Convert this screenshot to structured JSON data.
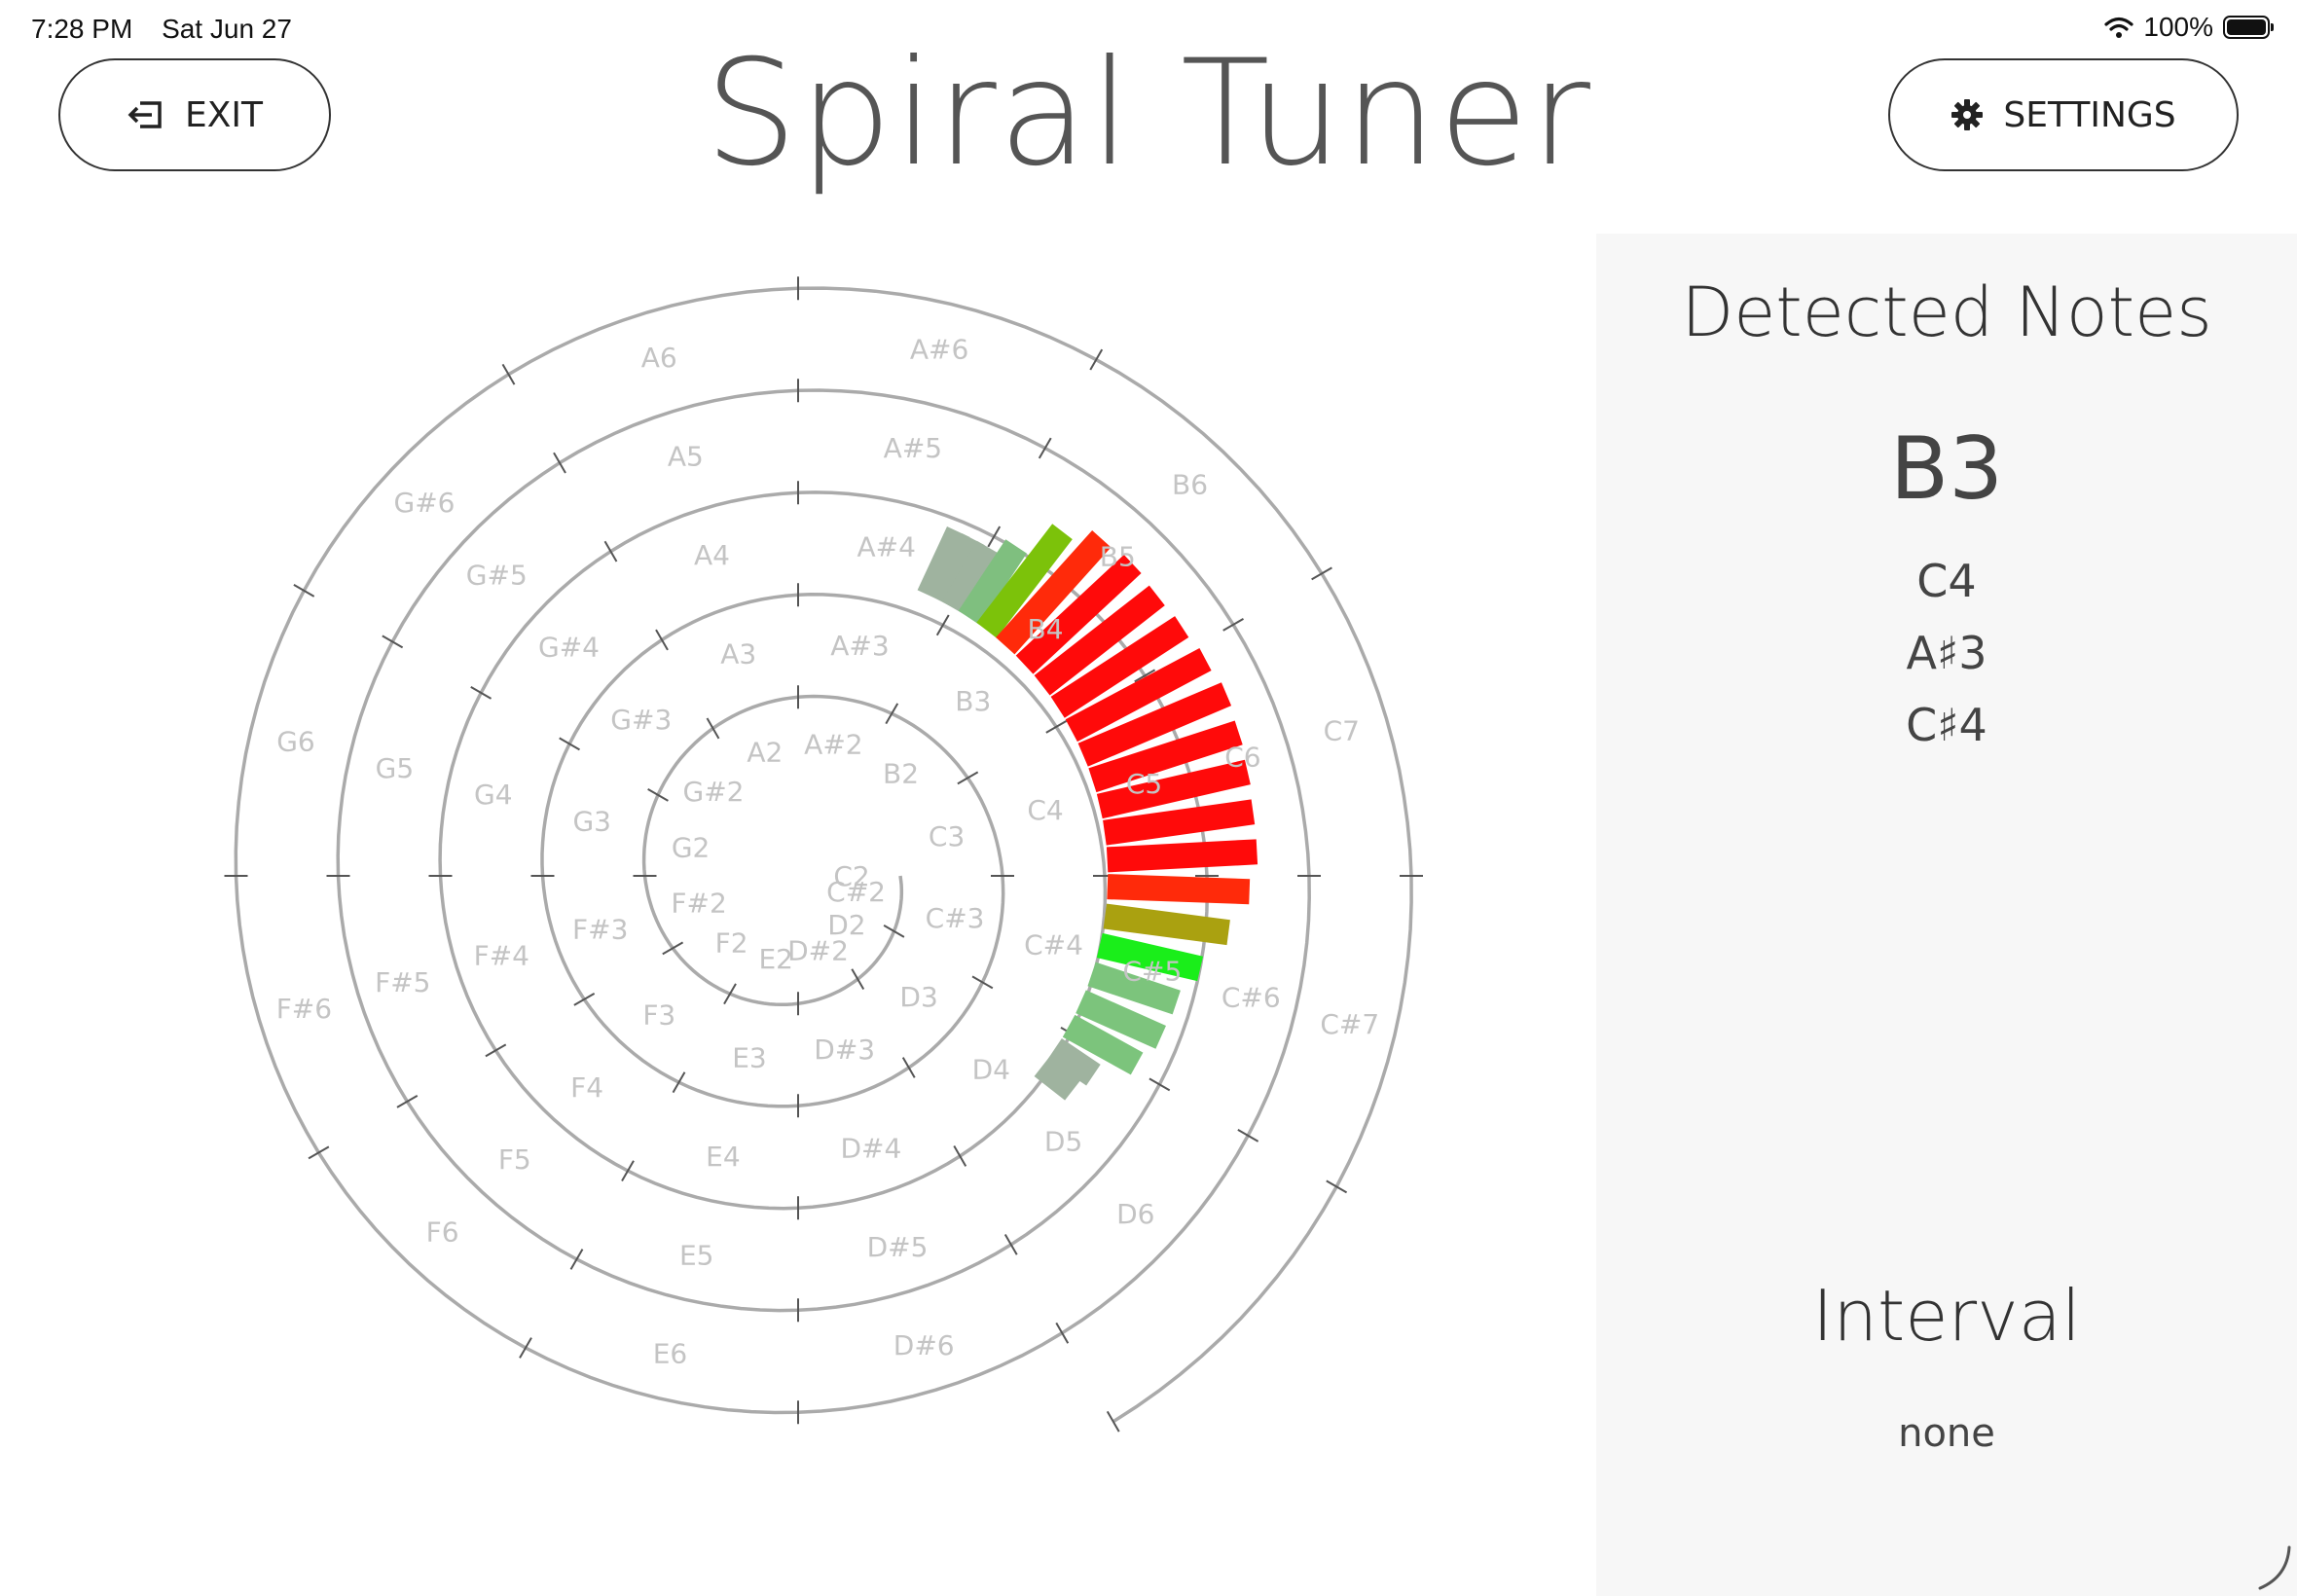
{
  "status_bar": {
    "time": "7:28 PM",
    "date": "Sat Jun 27",
    "battery_text": "100%",
    "icons": [
      "wifi-icon",
      "battery-icon"
    ]
  },
  "header": {
    "exit_label": "EXIT",
    "exit_icon": "exit-icon",
    "title": "Spiral Tuner",
    "settings_label": "SETTINGS",
    "settings_icon": "gear-icon"
  },
  "spiral": {
    "c_labels": [
      "C2",
      "C3",
      "C4",
      "C5",
      "C6",
      "C7"
    ],
    "notes": [
      [
        "C#2",
        "D2",
        "D#2",
        "E2",
        "F2",
        "F#2",
        "G2",
        "G#2",
        "A2",
        "A#2",
        "B2"
      ],
      [
        "C3",
        "C#3",
        "D3",
        "D#3",
        "E3",
        "F3",
        "F#3",
        "G3",
        "G#3",
        "A3",
        "A#3",
        "B3"
      ],
      [
        "C4",
        "C#4",
        "D4",
        "D#4",
        "E4",
        "F4",
        "F#4",
        "G4",
        "G#4",
        "A4",
        "A#4",
        "B4"
      ],
      [
        "C5",
        "C#5",
        "D5",
        "D#5",
        "E5",
        "F5",
        "F#5",
        "G5",
        "G#5",
        "A5",
        "A#5",
        "B5"
      ],
      [
        "C6",
        "C#6",
        "D6",
        "D#6",
        "E6",
        "F6",
        "F#6",
        "G6",
        "G#6",
        "A6",
        "A#6",
        "B6"
      ],
      [
        "C7",
        "C#7"
      ]
    ],
    "spectrum": {
      "bins": [
        {
          "deg": 25.0,
          "len": 72,
          "color": "#9fb39f"
        },
        {
          "deg": 27.5,
          "len": 72,
          "color": "#9fb39f"
        },
        {
          "deg": 30.0,
          "len": 72,
          "color": "#9fb39f"
        },
        {
          "deg": 33.5,
          "len": 88,
          "color": "#7fbf7f"
        },
        {
          "deg": 37.5,
          "len": 128,
          "color": "#7cc20a"
        },
        {
          "deg": 42.0,
          "len": 148,
          "color": "#ff2a0a"
        },
        {
          "deg": 47.0,
          "len": 152,
          "color": "#ff0a0a"
        },
        {
          "deg": 52.0,
          "len": 150,
          "color": "#ff0a0a"
        },
        {
          "deg": 57.0,
          "len": 152,
          "color": "#ff0a0a"
        },
        {
          "deg": 62.0,
          "len": 156,
          "color": "#ff0a0a"
        },
        {
          "deg": 67.0,
          "len": 160,
          "color": "#ff0a0a"
        },
        {
          "deg": 72.0,
          "len": 158,
          "color": "#ff0a0a"
        },
        {
          "deg": 77.0,
          "len": 156,
          "color": "#ff0a0a"
        },
        {
          "deg": 82.0,
          "len": 154,
          "color": "#ff0a0a"
        },
        {
          "deg": 87.0,
          "len": 154,
          "color": "#ff0a0a"
        },
        {
          "deg": 92.0,
          "len": 146,
          "color": "#ff2a0a"
        },
        {
          "deg": 97.5,
          "len": 128,
          "color": "#aaa110"
        },
        {
          "deg": 103.0,
          "len": 106,
          "color": "#1aee1a"
        },
        {
          "deg": 108.5,
          "len": 92,
          "color": "#7cc47c"
        },
        {
          "deg": 114.0,
          "len": 90,
          "color": "#7cc47c"
        },
        {
          "deg": 119.0,
          "len": 80,
          "color": "#7cc47c"
        },
        {
          "deg": 124.0,
          "len": 48,
          "color": "#9fb39f"
        },
        {
          "deg": 128.0,
          "len": 40,
          "color": "#9fb39f"
        }
      ]
    }
  },
  "panel": {
    "detected_heading": "Detected Notes",
    "primary_note": "B3",
    "other_notes": [
      "C4",
      "A♯3",
      "C♯4"
    ],
    "interval_heading": "Interval",
    "interval_value": "none"
  }
}
